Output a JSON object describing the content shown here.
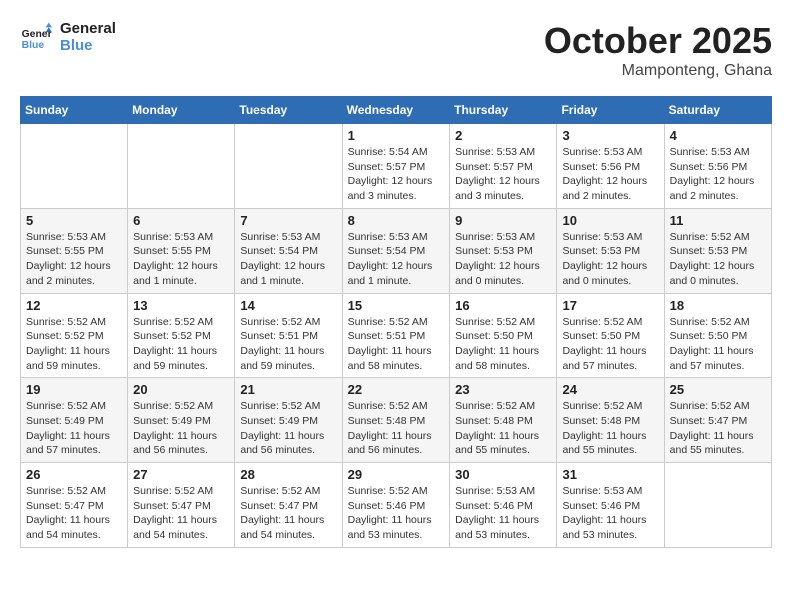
{
  "header": {
    "logo_line1": "General",
    "logo_line2": "Blue",
    "month": "October 2025",
    "location": "Mamponteng, Ghana"
  },
  "weekdays": [
    "Sunday",
    "Monday",
    "Tuesday",
    "Wednesday",
    "Thursday",
    "Friday",
    "Saturday"
  ],
  "weeks": [
    [
      {
        "day": null,
        "detail": null
      },
      {
        "day": null,
        "detail": null
      },
      {
        "day": null,
        "detail": null
      },
      {
        "day": "1",
        "detail": "Sunrise: 5:54 AM\nSunset: 5:57 PM\nDaylight: 12 hours\nand 3 minutes."
      },
      {
        "day": "2",
        "detail": "Sunrise: 5:53 AM\nSunset: 5:57 PM\nDaylight: 12 hours\nand 3 minutes."
      },
      {
        "day": "3",
        "detail": "Sunrise: 5:53 AM\nSunset: 5:56 PM\nDaylight: 12 hours\nand 2 minutes."
      },
      {
        "day": "4",
        "detail": "Sunrise: 5:53 AM\nSunset: 5:56 PM\nDaylight: 12 hours\nand 2 minutes."
      }
    ],
    [
      {
        "day": "5",
        "detail": "Sunrise: 5:53 AM\nSunset: 5:55 PM\nDaylight: 12 hours\nand 2 minutes."
      },
      {
        "day": "6",
        "detail": "Sunrise: 5:53 AM\nSunset: 5:55 PM\nDaylight: 12 hours\nand 1 minute."
      },
      {
        "day": "7",
        "detail": "Sunrise: 5:53 AM\nSunset: 5:54 PM\nDaylight: 12 hours\nand 1 minute."
      },
      {
        "day": "8",
        "detail": "Sunrise: 5:53 AM\nSunset: 5:54 PM\nDaylight: 12 hours\nand 1 minute."
      },
      {
        "day": "9",
        "detail": "Sunrise: 5:53 AM\nSunset: 5:53 PM\nDaylight: 12 hours\nand 0 minutes."
      },
      {
        "day": "10",
        "detail": "Sunrise: 5:53 AM\nSunset: 5:53 PM\nDaylight: 12 hours\nand 0 minutes."
      },
      {
        "day": "11",
        "detail": "Sunrise: 5:52 AM\nSunset: 5:53 PM\nDaylight: 12 hours\nand 0 minutes."
      }
    ],
    [
      {
        "day": "12",
        "detail": "Sunrise: 5:52 AM\nSunset: 5:52 PM\nDaylight: 11 hours\nand 59 minutes."
      },
      {
        "day": "13",
        "detail": "Sunrise: 5:52 AM\nSunset: 5:52 PM\nDaylight: 11 hours\nand 59 minutes."
      },
      {
        "day": "14",
        "detail": "Sunrise: 5:52 AM\nSunset: 5:51 PM\nDaylight: 11 hours\nand 59 minutes."
      },
      {
        "day": "15",
        "detail": "Sunrise: 5:52 AM\nSunset: 5:51 PM\nDaylight: 11 hours\nand 58 minutes."
      },
      {
        "day": "16",
        "detail": "Sunrise: 5:52 AM\nSunset: 5:50 PM\nDaylight: 11 hours\nand 58 minutes."
      },
      {
        "day": "17",
        "detail": "Sunrise: 5:52 AM\nSunset: 5:50 PM\nDaylight: 11 hours\nand 57 minutes."
      },
      {
        "day": "18",
        "detail": "Sunrise: 5:52 AM\nSunset: 5:50 PM\nDaylight: 11 hours\nand 57 minutes."
      }
    ],
    [
      {
        "day": "19",
        "detail": "Sunrise: 5:52 AM\nSunset: 5:49 PM\nDaylight: 11 hours\nand 57 minutes."
      },
      {
        "day": "20",
        "detail": "Sunrise: 5:52 AM\nSunset: 5:49 PM\nDaylight: 11 hours\nand 56 minutes."
      },
      {
        "day": "21",
        "detail": "Sunrise: 5:52 AM\nSunset: 5:49 PM\nDaylight: 11 hours\nand 56 minutes."
      },
      {
        "day": "22",
        "detail": "Sunrise: 5:52 AM\nSunset: 5:48 PM\nDaylight: 11 hours\nand 56 minutes."
      },
      {
        "day": "23",
        "detail": "Sunrise: 5:52 AM\nSunset: 5:48 PM\nDaylight: 11 hours\nand 55 minutes."
      },
      {
        "day": "24",
        "detail": "Sunrise: 5:52 AM\nSunset: 5:48 PM\nDaylight: 11 hours\nand 55 minutes."
      },
      {
        "day": "25",
        "detail": "Sunrise: 5:52 AM\nSunset: 5:47 PM\nDaylight: 11 hours\nand 55 minutes."
      }
    ],
    [
      {
        "day": "26",
        "detail": "Sunrise: 5:52 AM\nSunset: 5:47 PM\nDaylight: 11 hours\nand 54 minutes."
      },
      {
        "day": "27",
        "detail": "Sunrise: 5:52 AM\nSunset: 5:47 PM\nDaylight: 11 hours\nand 54 minutes."
      },
      {
        "day": "28",
        "detail": "Sunrise: 5:52 AM\nSunset: 5:47 PM\nDaylight: 11 hours\nand 54 minutes."
      },
      {
        "day": "29",
        "detail": "Sunrise: 5:52 AM\nSunset: 5:46 PM\nDaylight: 11 hours\nand 53 minutes."
      },
      {
        "day": "30",
        "detail": "Sunrise: 5:53 AM\nSunset: 5:46 PM\nDaylight: 11 hours\nand 53 minutes."
      },
      {
        "day": "31",
        "detail": "Sunrise: 5:53 AM\nSunset: 5:46 PM\nDaylight: 11 hours\nand 53 minutes."
      },
      {
        "day": null,
        "detail": null
      }
    ]
  ]
}
